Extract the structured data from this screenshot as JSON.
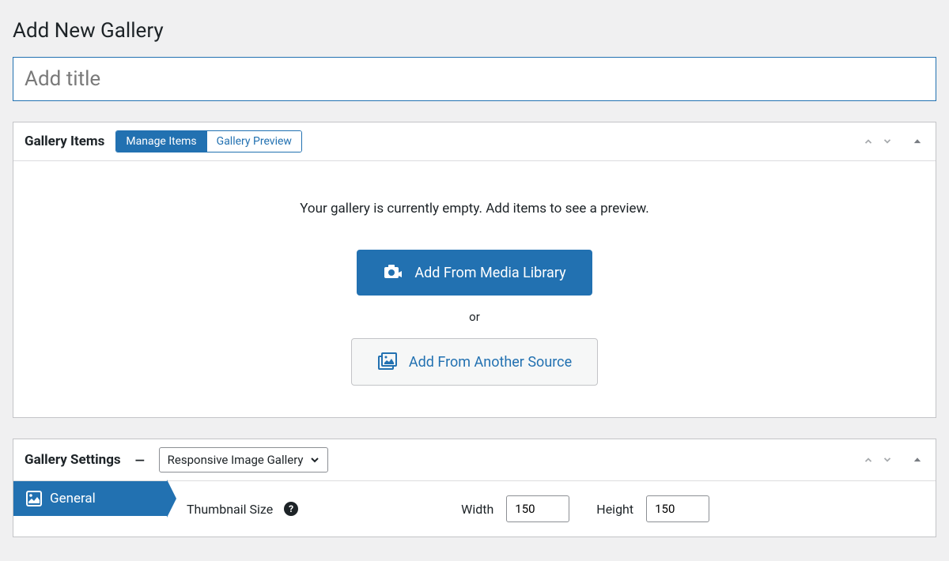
{
  "page": {
    "title": "Add New Gallery"
  },
  "title_input": {
    "placeholder": "Add title",
    "value": ""
  },
  "gallery_items": {
    "panel_title": "Gallery Items",
    "tabs": {
      "manage": "Manage Items",
      "preview": "Gallery Preview"
    },
    "empty_message": "Your gallery is currently empty. Add items to see a preview.",
    "add_media_label": "Add From Media Library",
    "or_label": "or",
    "add_other_label": "Add From Another Source"
  },
  "gallery_settings": {
    "panel_title": "Gallery Settings",
    "type_selected": "Responsive Image Gallery",
    "side_tab_general": "General",
    "thumb_label": "Thumbnail Size",
    "width_label": "Width",
    "height_label": "Height",
    "width_value": "150",
    "height_value": "150"
  }
}
